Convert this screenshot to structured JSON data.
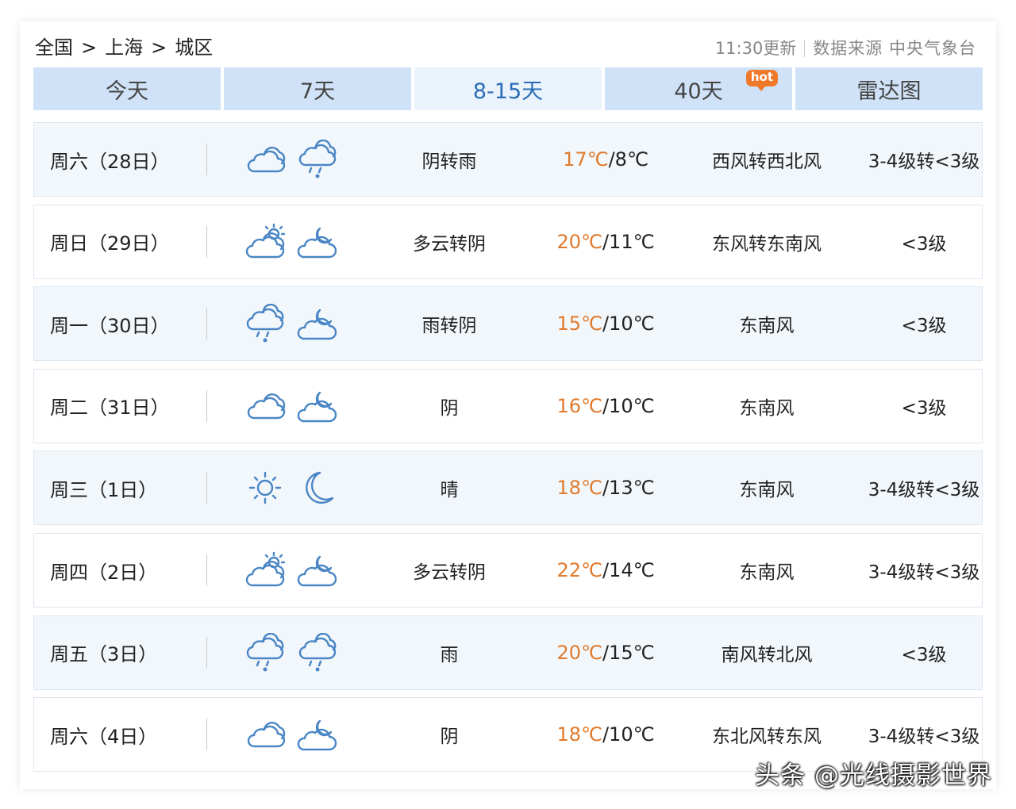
{
  "breadcrumb": {
    "country": "全国",
    "sep": ">",
    "city": "上海",
    "district": "城区"
  },
  "meta": {
    "updated": "11:30更新",
    "source": "数据来源 中央气象台"
  },
  "tabs": [
    {
      "label": "今天"
    },
    {
      "label": "7天"
    },
    {
      "label": "8-15天",
      "active": true
    },
    {
      "label": "40天",
      "badge": "hot"
    },
    {
      "label": "雷达图"
    }
  ],
  "forecast": [
    {
      "day": "周六（28日）",
      "icon_day": "cloudy-icon",
      "icon_night": "rain-icon",
      "desc": "阴转雨",
      "high": "17℃",
      "low": "8℃",
      "wind": "西风转西北风",
      "level": "3-4级转<3级"
    },
    {
      "day": "周日（29日）",
      "icon_day": "partly-cloudy-day-icon",
      "icon_night": "partly-cloudy-night-icon",
      "desc": "多云转阴",
      "high": "20℃",
      "low": "11℃",
      "wind": "东风转东南风",
      "level": "<3级"
    },
    {
      "day": "周一（30日）",
      "icon_day": "rain-icon",
      "icon_night": "partly-cloudy-night-icon",
      "desc": "雨转阴",
      "high": "15℃",
      "low": "10℃",
      "wind": "东南风",
      "level": "<3级"
    },
    {
      "day": "周二（31日）",
      "icon_day": "cloudy-icon",
      "icon_night": "partly-cloudy-night-icon",
      "desc": "阴",
      "high": "16℃",
      "low": "10℃",
      "wind": "东南风",
      "level": "<3级"
    },
    {
      "day": "周三（1日）",
      "icon_day": "sun-icon",
      "icon_night": "moon-icon",
      "desc": "晴",
      "high": "18℃",
      "low": "13℃",
      "wind": "东南风",
      "level": "3-4级转<3级"
    },
    {
      "day": "周四（2日）",
      "icon_day": "partly-cloudy-day-icon",
      "icon_night": "partly-cloudy-night-icon",
      "desc": "多云转阴",
      "high": "22℃",
      "low": "14℃",
      "wind": "东南风",
      "level": "3-4级转<3级"
    },
    {
      "day": "周五（3日）",
      "icon_day": "rain-icon",
      "icon_night": "rain-icon",
      "desc": "雨",
      "high": "20℃",
      "low": "15℃",
      "wind": "南风转北风",
      "level": "<3级"
    },
    {
      "day": "周六（4日）",
      "icon_day": "cloudy-icon",
      "icon_night": "partly-cloudy-night-icon",
      "desc": "阴",
      "high": "18℃",
      "low": "10℃",
      "wind": "东北风转东风",
      "level": "3-4级转<3级"
    }
  ],
  "temp_sep": "/",
  "watermark": "头条 @光线摄影世界",
  "colors": {
    "tab_bg": "#cfe2f7",
    "tab_active_bg": "#eaf3fc",
    "tab_active_text": "#2a6db5",
    "high_temp": "#e07a2c",
    "icon": "#4a86c5",
    "hot_badge": "#f07a2a"
  }
}
